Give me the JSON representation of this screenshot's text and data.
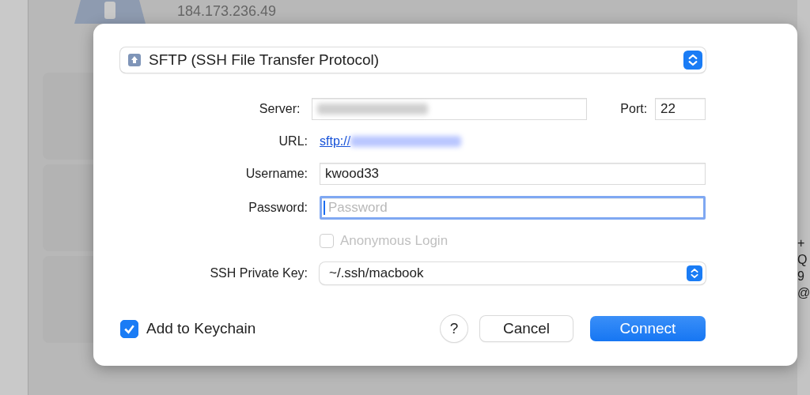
{
  "background": {
    "host_address": "184.173.236.49",
    "column_fragments": [
      "+",
      "Q",
      "9",
      "@"
    ]
  },
  "dialog": {
    "protocol": {
      "value": "SFTP (SSH File Transfer Protocol)"
    },
    "server": {
      "label": "Server:",
      "redacted": true
    },
    "port": {
      "label": "Port:",
      "value": "22"
    },
    "url": {
      "label": "URL:",
      "link": "sftp://",
      "redacted": true
    },
    "username": {
      "label": "Username:",
      "value": "kwood33"
    },
    "password": {
      "label": "Password:",
      "placeholder": "Password",
      "focused": true
    },
    "anonymous_login": {
      "label": "Anonymous Login",
      "checked": false,
      "disabled": true
    },
    "ssh_private_key": {
      "label": "SSH Private Key:",
      "value": "~/.ssh/macbook"
    },
    "add_to_keychain": {
      "label": "Add to Keychain",
      "checked": true
    },
    "buttons": [
      {
        "kind": "help",
        "label": "?"
      },
      {
        "kind": "secondary",
        "label": "Cancel"
      },
      {
        "kind": "primary",
        "label": "Connect"
      }
    ]
  }
}
